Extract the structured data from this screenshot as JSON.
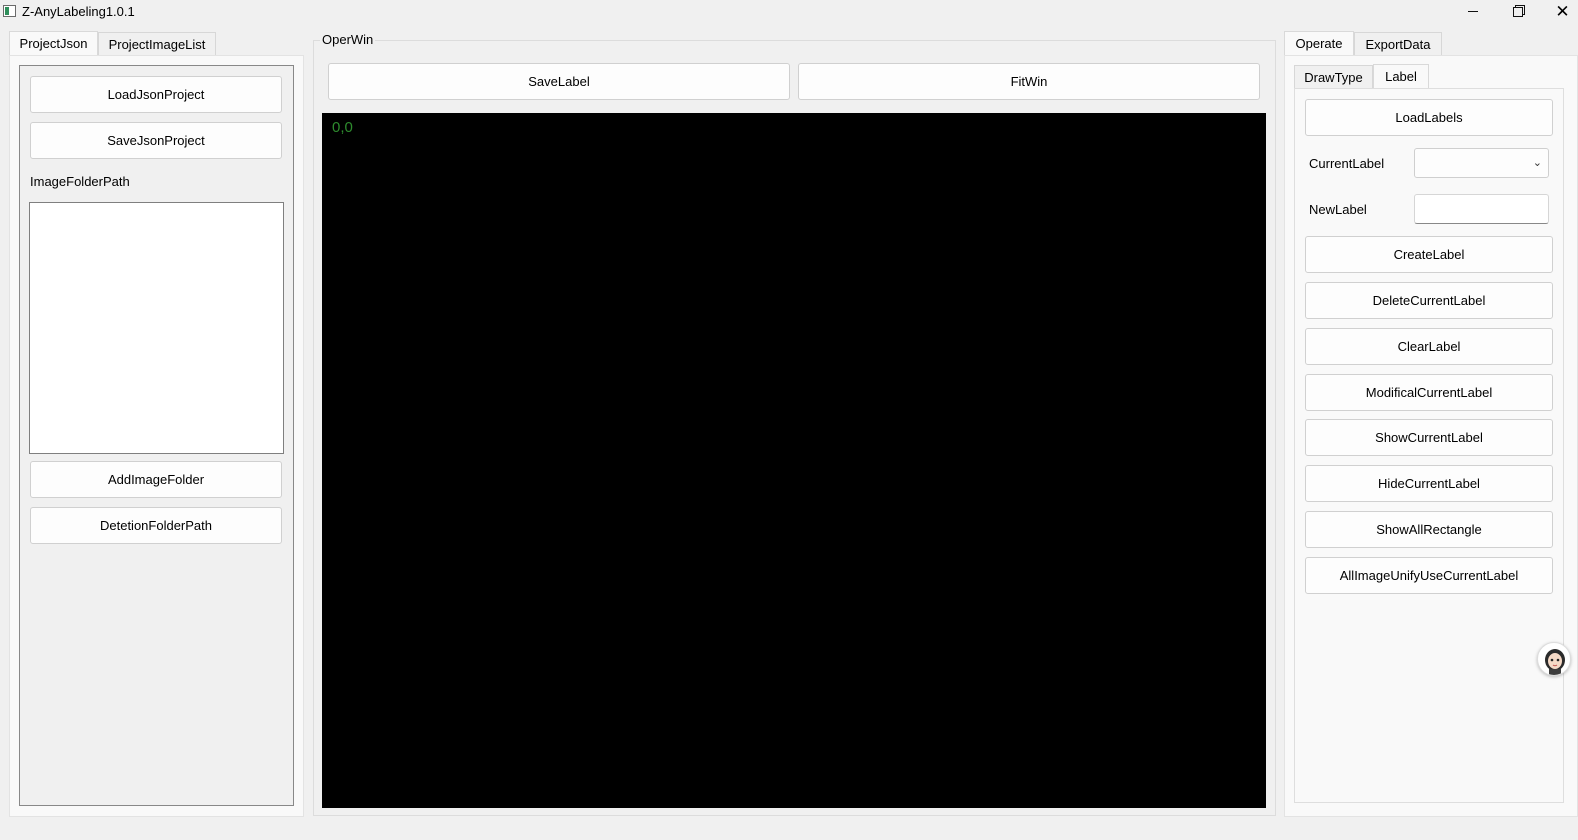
{
  "window": {
    "title": "Z-AnyLabeling1.0.1",
    "close_glyph": "✕"
  },
  "left": {
    "tabs": [
      "ProjectJson",
      "ProjectImageList"
    ],
    "load_json_project": "LoadJsonProject",
    "save_json_project": "SaveJsonProject",
    "image_folder_path_label": "ImageFolderPath",
    "add_image_folder": "AddImageFolder",
    "detection_folder_path": "DetetionFolderPath"
  },
  "center": {
    "group_title": "OperWin",
    "save_label": "SaveLabel",
    "fit_win": "FitWin",
    "coordinate_readout": "0,0",
    "canvas_background": "#000000",
    "coordinate_color": "#2e8b2e"
  },
  "right": {
    "tabs": [
      "Operate",
      "ExportData"
    ],
    "subtabs": [
      "DrawType",
      "Label"
    ],
    "load_labels": "LoadLabels",
    "current_label_caption": "CurrentLabel",
    "current_label_value": "",
    "new_label_caption": "NewLabel",
    "new_label_value": "",
    "buttons": [
      "CreateLabel",
      "DeleteCurrentLabel",
      "ClearLabel",
      "ModificalCurrentLabel",
      "ShowCurrentLabel",
      "HideCurrentLabel",
      "ShowAllRectangle",
      "AllImageUnifyUseCurrentLabel"
    ]
  },
  "icons": {
    "app": "app-icon",
    "minimize": "minimize-icon",
    "maximize": "maximize-icon",
    "close": "close-icon",
    "dropdown": "chevron-down-icon",
    "assistant": "avatar-icon"
  }
}
